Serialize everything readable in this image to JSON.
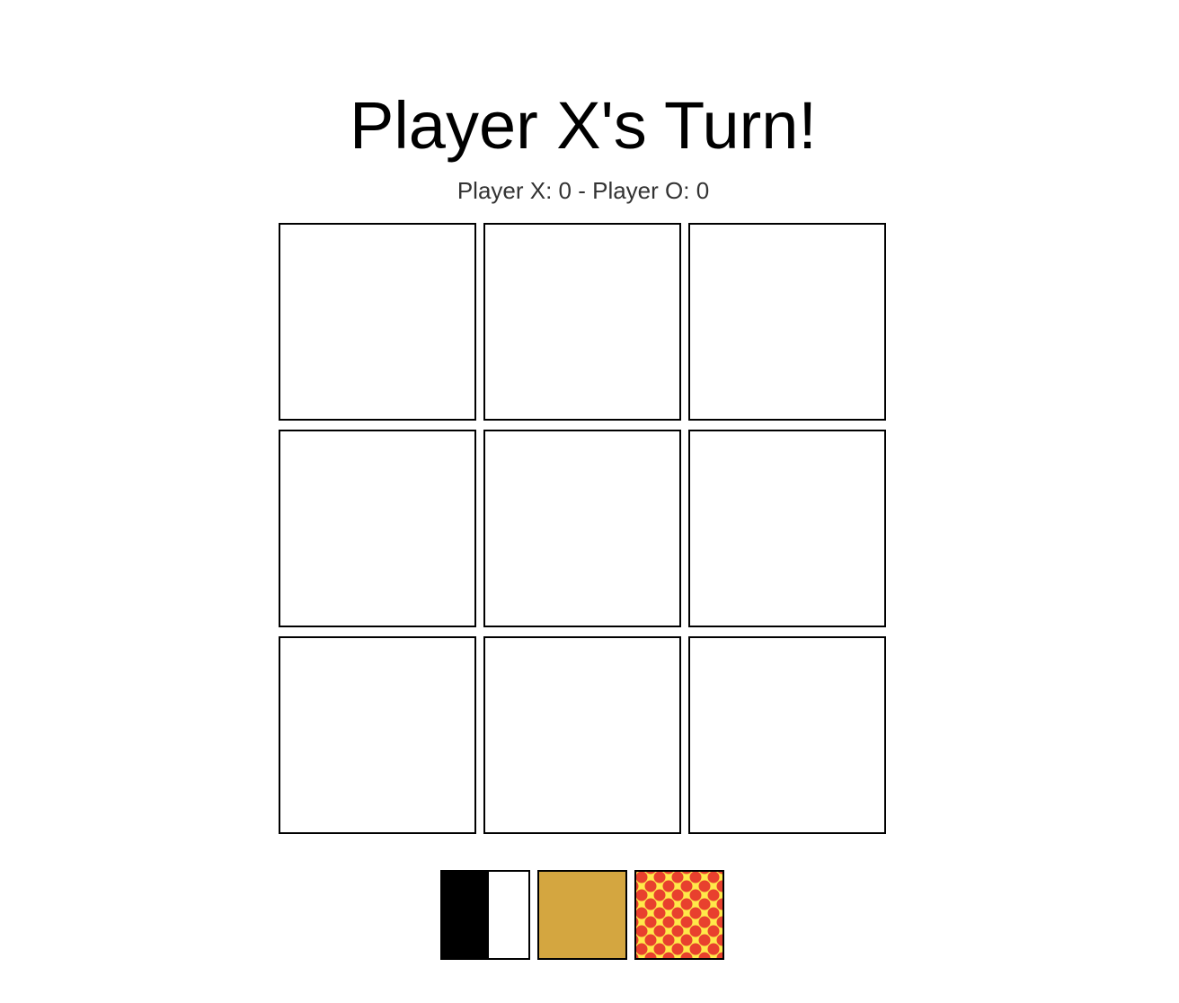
{
  "status": {
    "turn_text": "Player X's Turn!",
    "score_text": "Player X: 0 - Player O: 0"
  },
  "board": {
    "cells": [
      "",
      "",
      "",
      "",
      "",
      "",
      "",
      "",
      ""
    ]
  },
  "themes": [
    {
      "name": "black-white-half",
      "colors": [
        "#000000",
        "#ffffff"
      ]
    },
    {
      "name": "gold",
      "colors": [
        "#d4a640"
      ]
    },
    {
      "name": "red-dots-on-yellow",
      "colors": [
        "#ffe94a",
        "#e8402e"
      ]
    }
  ]
}
